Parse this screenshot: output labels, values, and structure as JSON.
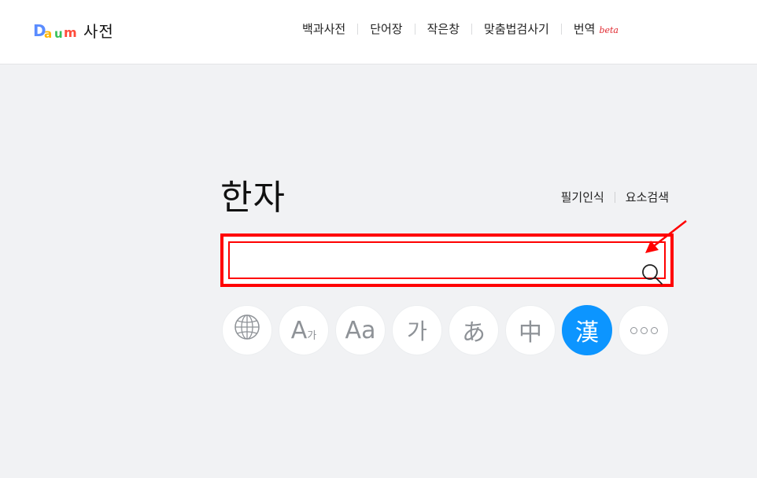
{
  "header": {
    "logo_text": "Daum",
    "logo_parts": [
      "D",
      "a",
      "u",
      "m"
    ],
    "service_name": "사전",
    "nav": [
      {
        "label": "백과사전"
      },
      {
        "label": "단어장"
      },
      {
        "label": "작은창"
      },
      {
        "label": "맞춤법검사기"
      },
      {
        "label": "번역",
        "badge": "beta"
      }
    ]
  },
  "main": {
    "title": "한자",
    "links": [
      "필기인식",
      "요소검색"
    ],
    "search": {
      "value": "",
      "placeholder": ""
    },
    "languages": [
      {
        "name": "globe-icon",
        "glyph": ""
      },
      {
        "name": "english-korean",
        "glyph": "A",
        "sub": "가"
      },
      {
        "name": "english",
        "glyph": "Aa"
      },
      {
        "name": "korean",
        "glyph": "가"
      },
      {
        "name": "japanese",
        "glyph": "あ"
      },
      {
        "name": "chinese",
        "glyph": "中"
      },
      {
        "name": "hanja",
        "glyph": "漢",
        "active": true
      },
      {
        "name": "more",
        "glyph": ""
      }
    ]
  },
  "colors": {
    "accent": "#0c95ff",
    "highlight": "#ff0000",
    "background": "#f1f2f4"
  }
}
